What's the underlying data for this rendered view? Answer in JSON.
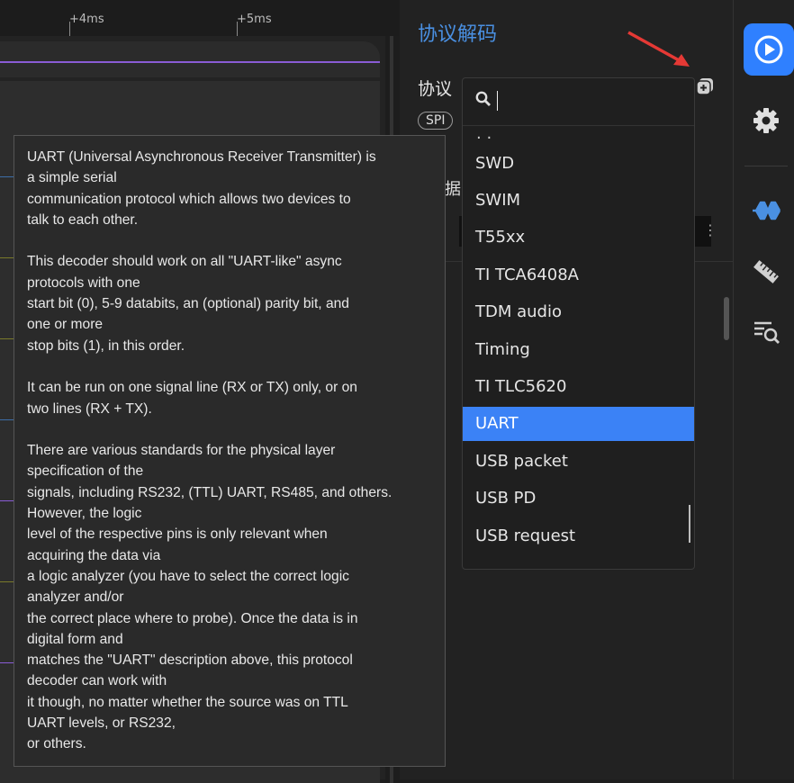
{
  "ruler": {
    "ticks": [
      "+4ms",
      "+5ms"
    ]
  },
  "panel": {
    "title": "协议解码",
    "protocol_label": "协议",
    "spi_chip": "SPI",
    "fragment_char": "据",
    "kebab": "⋮"
  },
  "dropdown": {
    "search_value": "",
    "partial_item": "· ·",
    "items": [
      "SWD",
      "SWIM",
      "T55xx",
      "TI TCA6408A",
      "TDM audio",
      "Timing",
      "TI TLC5620",
      "UART",
      "USB packet",
      "USB PD",
      "USB request"
    ],
    "selected": "UART"
  },
  "tooltip": {
    "text": "UART (Universal Asynchronous Receiver Transmitter) is\na simple serial\ncommunication protocol which allows two devices to\ntalk to each other.\n\nThis decoder should work on all \"UART-like\" async\nprotocols with one\nstart bit (0), 5-9 databits, an (optional) parity bit, and\none or more\nstop bits (1), in this order.\n\nIt can be run on one signal line (RX or TX) only, or on\ntwo lines (RX + TX).\n\nThere are various standards for the physical layer\nspecification of the\nsignals, including RS232, (TTL) UART, RS485, and others.\nHowever, the logic\nlevel of the respective pins is only relevant when\nacquiring the data via\na logic analyzer (you have to select the correct logic\nanalyzer and/or\nthe correct place where to probe). Once the data is in\ndigital form and\nmatches the \"UART\" description above, this protocol\ndecoder can work with\nit though, no matter whether the source was on TTL\nUART levels, or RS232,\nor others."
  },
  "colors": {
    "accent": "#4a90e2",
    "selected": "#3b82f6",
    "play_button": "#2f80ff",
    "signal": "#8a5cd6",
    "arrow": "#e53935"
  },
  "icons": {
    "add": "add-decoder-icon",
    "play": "play-icon",
    "settings": "gear-icon",
    "decoder": "protocol-decoder-icon",
    "measure": "ruler-icon",
    "search_list": "search-list-icon"
  }
}
